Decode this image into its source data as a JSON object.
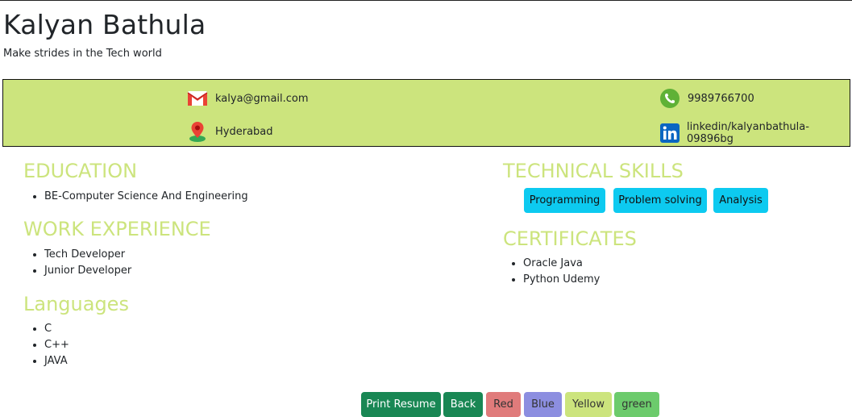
{
  "header": {
    "name": "Kalyan Bathula",
    "tagline": "Make strides in the Tech world"
  },
  "contact": {
    "email": "kalya@gmail.com",
    "phone": "9989766700",
    "location": "Hyderabad",
    "linkedin": "linkedin/kalyanbathula-09896bg"
  },
  "education": {
    "title": "EDUCATION",
    "items": [
      "BE-Computer Science And Engineering"
    ]
  },
  "work": {
    "title": "WORK EXPERIENCE",
    "items": [
      "Tech Developer",
      "Junior Developer"
    ]
  },
  "languages": {
    "title": "Languages",
    "items": [
      "C",
      "C++",
      "JAVA"
    ]
  },
  "skills": {
    "title": "TECHNICAL SKILLS",
    "items": [
      "Programming",
      "Problem solving",
      "Analysis"
    ]
  },
  "certificates": {
    "title": "CERTIFICATES",
    "items": [
      "Oracle Java",
      "Python Udemy"
    ]
  },
  "actions": {
    "print": "Print Resume",
    "back": "Back",
    "red": "Red",
    "blue": "Blue",
    "yellow": "Yellow",
    "green": "green"
  },
  "colors": {
    "accent": "#cce47d",
    "skill_badge": "#0dcaf0",
    "print": "#198754",
    "back": "#198754",
    "red": "#e07b7b",
    "blue": "#8c8ee0",
    "yellow": "#cce47d",
    "green": "#6ccb6c"
  }
}
